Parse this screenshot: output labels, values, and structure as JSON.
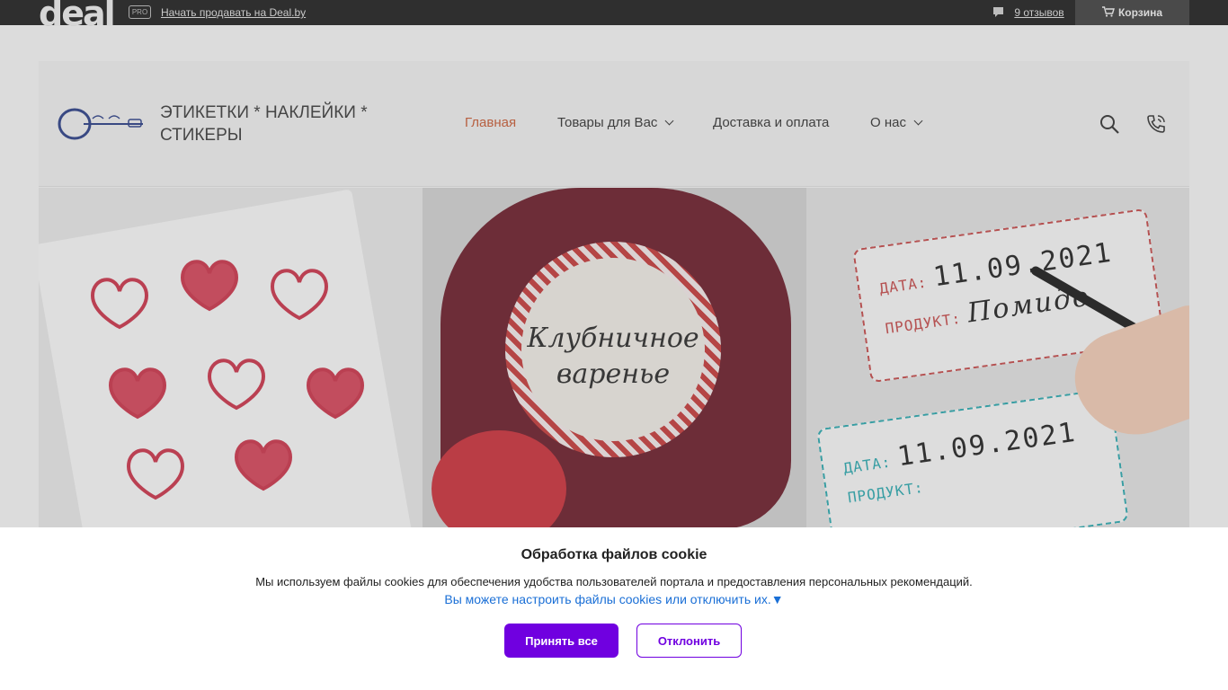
{
  "topbar": {
    "logo": "deal",
    "pro_badge": "PRO",
    "sell_link": "Начать продавать на Deal.by",
    "reviews": "9 отзывов",
    "cart": "Корзина"
  },
  "header": {
    "title_line1": "ЭТИКЕТКИ * НАКЛЕЙКИ *",
    "title_line2": "СТИКЕРЫ",
    "nav": [
      {
        "label": "Главная",
        "active": true
      },
      {
        "label": "Товары для Вас",
        "dropdown": true
      },
      {
        "label": "Доставка и оплата"
      },
      {
        "label": "О нас",
        "dropdown": true
      }
    ],
    "icons": [
      "search-icon",
      "phone-icon"
    ]
  },
  "banner": {
    "jar_text_1": "Клубничное",
    "jar_text_2": "варенье",
    "tag_top": {
      "date_label": "ДАТА:",
      "date_value": "11.09.2021",
      "product_label": "ПРОДУКТ:",
      "product_value": "Помидо"
    },
    "tag_bottom": {
      "date_label": "ДАТА:",
      "date_value": "11.09.2021",
      "product_label": "ПРОДУКТ:"
    }
  },
  "cookie": {
    "title": "Обработка файлов cookie",
    "text": "Мы используем файлы cookies для обеспечения удобства пользователей портала и предоставления персональных рекомендаций.",
    "link": "Вы можете настроить файлы cookies или отключить их.▼",
    "accept": "Принять все",
    "reject": "Отклонить"
  },
  "colors": {
    "accent_purple": "#7000e0",
    "nav_active": "#c55a34",
    "link_blue": "#1a6fd6"
  }
}
